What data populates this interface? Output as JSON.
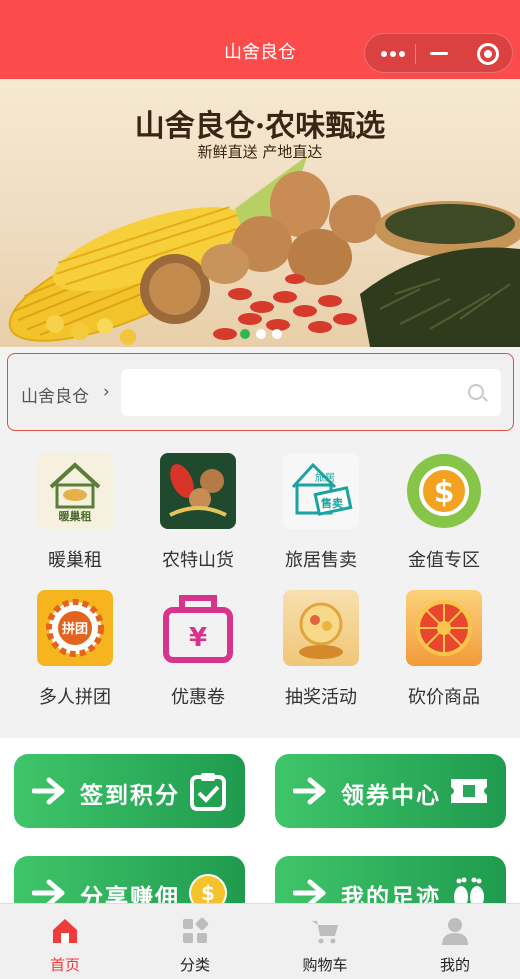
{
  "header": {
    "title": "山舍良仓"
  },
  "banner": {
    "title": "山舍良仓·农味甄选",
    "subtitle": "新鲜直送 产地直达",
    "slide_count": 3,
    "active_slide": 1
  },
  "search": {
    "label": "山舍良仓",
    "chevron": "›",
    "placeholder": "",
    "icon": "search-icon"
  },
  "categories": [
    {
      "label": "暖巢租",
      "icon": "warm-nest-rent-icon",
      "icon_text": "暖巢租"
    },
    {
      "label": "农特山货",
      "icon": "farm-produce-icon"
    },
    {
      "label": "旅居售卖",
      "icon": "travel-stay-sale-icon",
      "icon_text_1": "旅居",
      "icon_text_2": "售卖"
    },
    {
      "label": "金值专区",
      "icon": "dollar-coin-icon",
      "icon_text": "$"
    },
    {
      "label": "多人拼团",
      "icon": "group-buy-icon",
      "icon_text": "拼团"
    },
    {
      "label": "优惠卷",
      "icon": "coupon-bag-icon",
      "icon_text": "¥"
    },
    {
      "label": "抽奖活动",
      "icon": "lottery-icon"
    },
    {
      "label": "砍价商品",
      "icon": "bargain-wheel-icon"
    }
  ],
  "actions": [
    {
      "label": "签到积分",
      "icon": "checkin-clipboard-icon"
    },
    {
      "label": "领券中心",
      "icon": "ticket-icon"
    },
    {
      "label": "分享赚佣",
      "icon": "coin-icon"
    },
    {
      "label": "我的足迹",
      "icon": "footprint-icon"
    }
  ],
  "tabbar": [
    {
      "label": "首页",
      "icon": "home-icon",
      "active": true
    },
    {
      "label": "分类",
      "icon": "category-icon",
      "active": false
    },
    {
      "label": "购物车",
      "icon": "cart-icon",
      "active": false
    },
    {
      "label": "我的",
      "icon": "user-icon",
      "active": false
    }
  ],
  "colors": {
    "brand": "#fb4b4b",
    "action_green": "#2db35c",
    "active_tab": "#f03b3b"
  }
}
